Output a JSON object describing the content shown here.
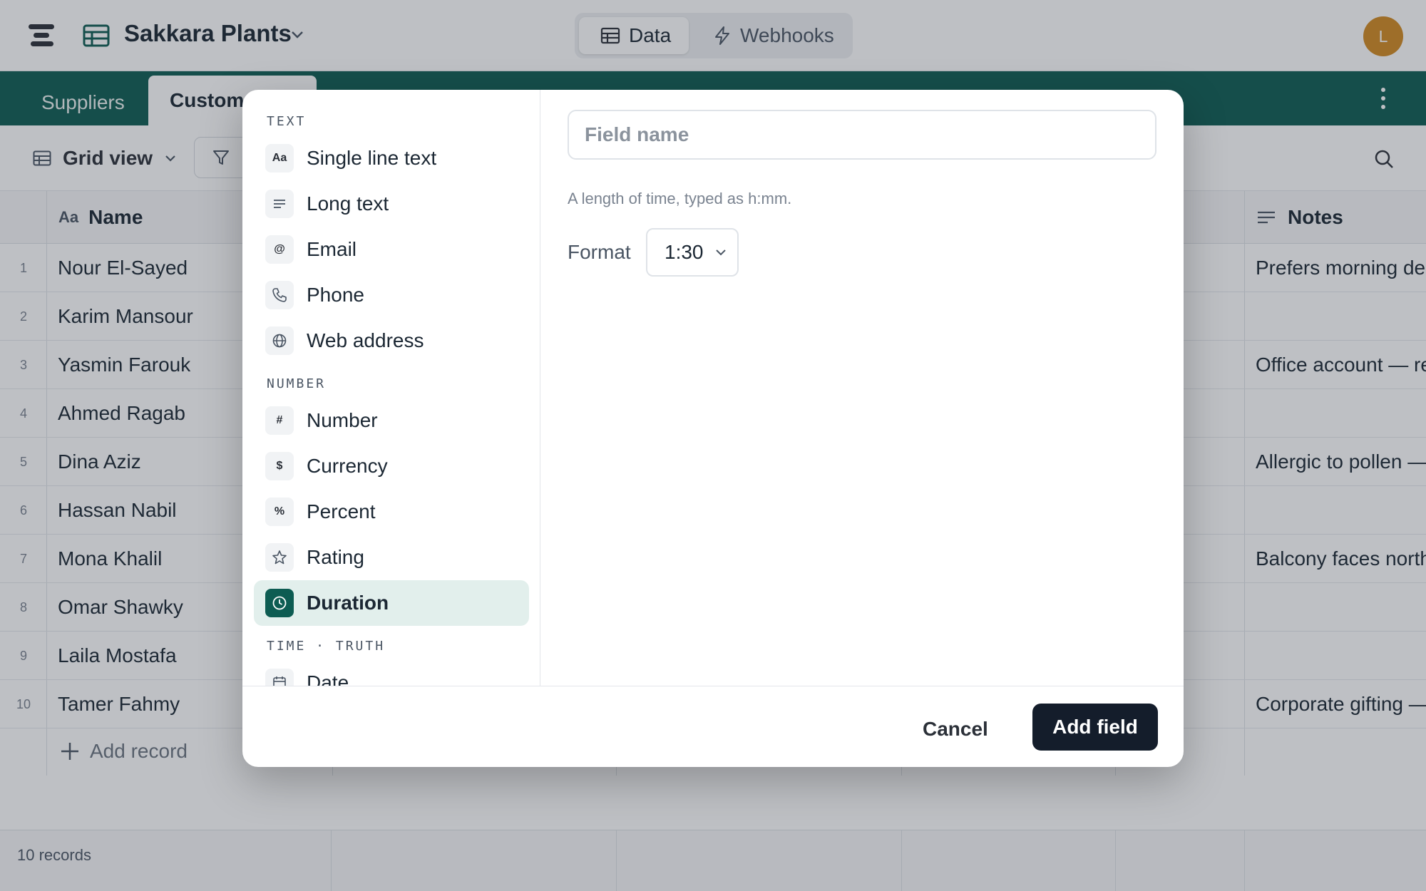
{
  "app": {
    "base_name": "Sakkara Plants",
    "avatar_initial": "L",
    "accent_color": "#0d5c52"
  },
  "header": {
    "tabs": [
      {
        "label": "Data",
        "icon": "table-icon",
        "active": true
      },
      {
        "label": "Webhooks",
        "icon": "lightning-icon",
        "active": false
      }
    ]
  },
  "table_tabs": [
    {
      "label": "Suppliers",
      "active": false
    },
    {
      "label": "Custome",
      "active": true
    }
  ],
  "toolbar": {
    "view_label": "Grid view"
  },
  "grid": {
    "columns": [
      {
        "label": "Name",
        "icon": "text-aa-icon"
      },
      {
        "label": "Notes",
        "icon": "long-text-icon"
      }
    ],
    "rows": [
      {
        "num": "1",
        "name": "Nour El-Sayed",
        "notes": "Prefers morning del"
      },
      {
        "num": "2",
        "name": "Karim Mansour",
        "notes": ""
      },
      {
        "num": "3",
        "name": "Yasmin Farouk",
        "notes": "Office account — re"
      },
      {
        "num": "4",
        "name": "Ahmed Ragab",
        "notes": ""
      },
      {
        "num": "5",
        "name": "Dina Aziz",
        "notes": "Allergic to pollen —"
      },
      {
        "num": "6",
        "name": "Hassan Nabil",
        "notes": ""
      },
      {
        "num": "7",
        "name": "Mona Khalil",
        "notes": "Balcony faces north"
      },
      {
        "num": "8",
        "name": "Omar Shawky",
        "notes": ""
      },
      {
        "num": "9",
        "name": "Laila Mostafa",
        "notes": ""
      },
      {
        "num": "10",
        "name": "Tamer Fahmy",
        "notes": "Corporate gifting —"
      }
    ],
    "add_record_label": "Add record",
    "record_count": "10 records"
  },
  "modal": {
    "sections": [
      {
        "title": "TEXT",
        "items": [
          {
            "label": "Single line text",
            "icon": "Aa",
            "icon_name": "text-aa-icon"
          },
          {
            "label": "Long text",
            "icon": "≡",
            "icon_name": "long-text-icon"
          },
          {
            "label": "Email",
            "icon": "@",
            "icon_name": "at-sign-icon"
          },
          {
            "label": "Phone",
            "icon": "",
            "icon_name": "phone-icon"
          },
          {
            "label": "Web address",
            "icon": "",
            "icon_name": "globe-icon"
          }
        ]
      },
      {
        "title": "NUMBER",
        "items": [
          {
            "label": "Number",
            "icon": "#",
            "icon_name": "hash-icon"
          },
          {
            "label": "Currency",
            "icon": "$",
            "icon_name": "dollar-icon"
          },
          {
            "label": "Percent",
            "icon": "%",
            "icon_name": "percent-icon"
          },
          {
            "label": "Rating",
            "icon": "",
            "icon_name": "star-icon"
          },
          {
            "label": "Duration",
            "icon": "",
            "icon_name": "clock-icon",
            "selected": true
          }
        ]
      },
      {
        "title": "TIME · TRUTH",
        "items": [
          {
            "label": "Date",
            "icon": "",
            "icon_name": "calendar-icon"
          }
        ]
      }
    ],
    "field_name_placeholder": "Field name",
    "field_name_value": "",
    "hint": "A length of time, typed as h:mm.",
    "format_label": "Format",
    "format_value": "1:30",
    "cancel_label": "Cancel",
    "add_label": "Add field"
  }
}
